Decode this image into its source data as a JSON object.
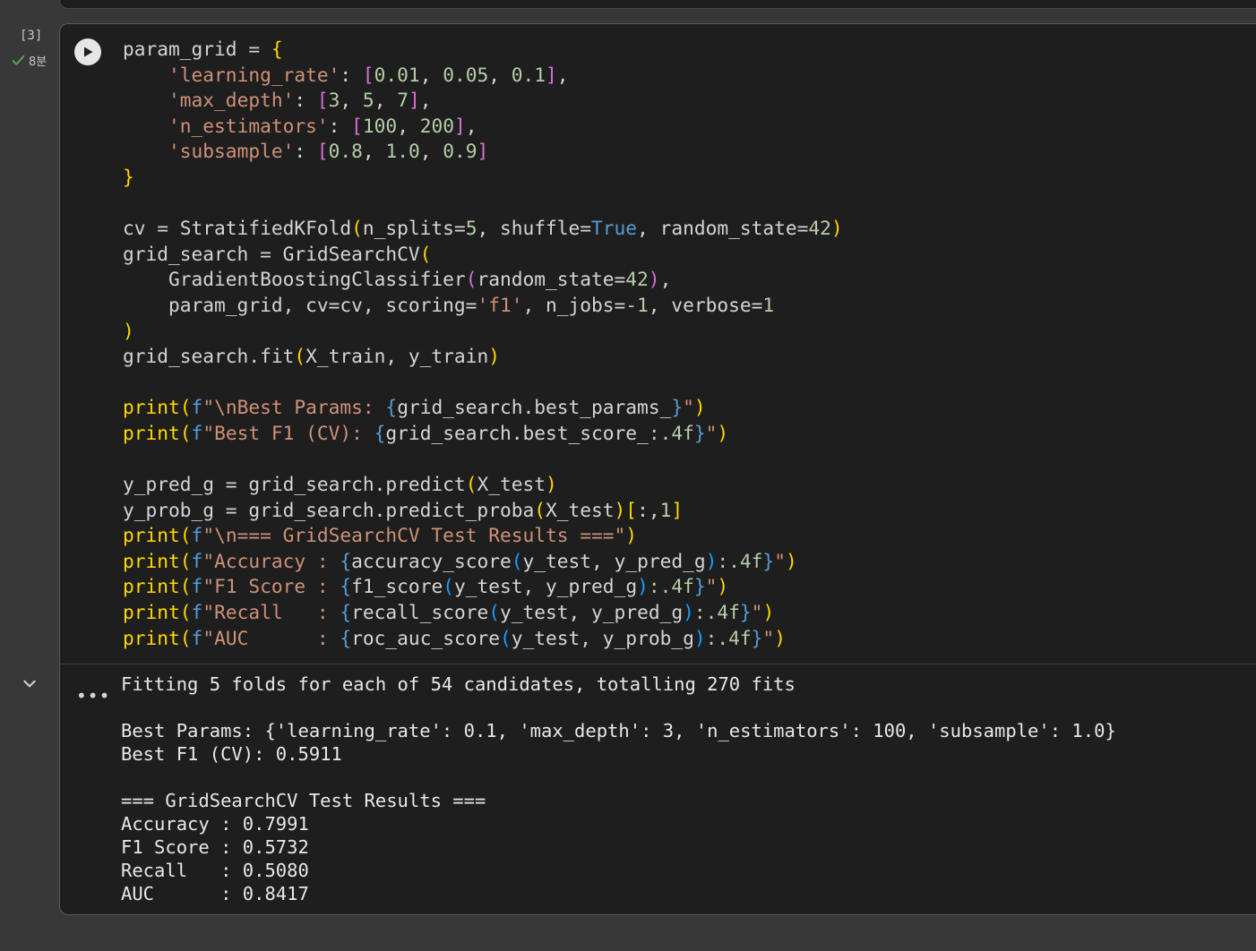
{
  "cell": {
    "execution_count": "[3]",
    "elapsed": "8분",
    "code_lines": [
      [
        {
          "t": "param_grid = "
        },
        {
          "t": "{",
          "c": "y"
        }
      ],
      [
        {
          "t": "    "
        },
        {
          "t": "'learning_rate'",
          "c": "s"
        },
        {
          "t": ": "
        },
        {
          "t": "[",
          "c": "m"
        },
        {
          "t": "0.01",
          "c": "n"
        },
        {
          "t": ", "
        },
        {
          "t": "0.05",
          "c": "n"
        },
        {
          "t": ", "
        },
        {
          "t": "0.1",
          "c": "n"
        },
        {
          "t": "]",
          "c": "m"
        },
        {
          "t": ","
        }
      ],
      [
        {
          "t": "    "
        },
        {
          "t": "'max_depth'",
          "c": "s"
        },
        {
          "t": ": "
        },
        {
          "t": "[",
          "c": "m"
        },
        {
          "t": "3",
          "c": "n"
        },
        {
          "t": ", "
        },
        {
          "t": "5",
          "c": "n"
        },
        {
          "t": ", "
        },
        {
          "t": "7",
          "c": "n"
        },
        {
          "t": "]",
          "c": "m"
        },
        {
          "t": ","
        }
      ],
      [
        {
          "t": "    "
        },
        {
          "t": "'n_estimators'",
          "c": "s"
        },
        {
          "t": ": "
        },
        {
          "t": "[",
          "c": "m"
        },
        {
          "t": "100",
          "c": "n"
        },
        {
          "t": ", "
        },
        {
          "t": "200",
          "c": "n"
        },
        {
          "t": "]",
          "c": "m"
        },
        {
          "t": ","
        }
      ],
      [
        {
          "t": "    "
        },
        {
          "t": "'subsample'",
          "c": "s"
        },
        {
          "t": ": "
        },
        {
          "t": "[",
          "c": "m"
        },
        {
          "t": "0.8",
          "c": "n"
        },
        {
          "t": ", "
        },
        {
          "t": "1.0",
          "c": "n"
        },
        {
          "t": ", "
        },
        {
          "t": "0.9",
          "c": "n"
        },
        {
          "t": "]",
          "c": "m"
        }
      ],
      [
        {
          "t": "}",
          "c": "y"
        }
      ],
      [
        {
          "t": ""
        }
      ],
      [
        {
          "t": "cv = StratifiedKFold"
        },
        {
          "t": "(",
          "c": "y"
        },
        {
          "t": "n_splits="
        },
        {
          "t": "5",
          "c": "n"
        },
        {
          "t": ", shuffle="
        },
        {
          "t": "True",
          "c": "b"
        },
        {
          "t": ", random_state="
        },
        {
          "t": "42",
          "c": "n"
        },
        {
          "t": ")",
          "c": "y"
        }
      ],
      [
        {
          "t": "grid_search = GridSearchCV"
        },
        {
          "t": "(",
          "c": "y"
        }
      ],
      [
        {
          "t": "    GradientBoostingClassifier"
        },
        {
          "t": "(",
          "c": "m"
        },
        {
          "t": "random_state="
        },
        {
          "t": "42",
          "c": "n"
        },
        {
          "t": ")",
          "c": "m"
        },
        {
          "t": ","
        }
      ],
      [
        {
          "t": "    param_grid, cv=cv, scoring="
        },
        {
          "t": "'f1'",
          "c": "s"
        },
        {
          "t": ", n_jobs="
        },
        {
          "t": "-1",
          "c": "n"
        },
        {
          "t": ", verbose="
        },
        {
          "t": "1",
          "c": "n"
        }
      ],
      [
        {
          "t": ")",
          "c": "y"
        }
      ],
      [
        {
          "t": "grid_search.fit"
        },
        {
          "t": "(",
          "c": "y"
        },
        {
          "t": "X_train, y_train"
        },
        {
          "t": ")",
          "c": "y"
        }
      ],
      [
        {
          "t": ""
        }
      ],
      [
        {
          "t": "print",
          "c": "y"
        },
        {
          "t": "(",
          "c": "y"
        },
        {
          "t": "f",
          "c": "b"
        },
        {
          "t": "\"\\nBest Params: ",
          "c": "s"
        },
        {
          "t": "{",
          "c": "b"
        },
        {
          "t": "grid_search.best_params_"
        },
        {
          "t": "}",
          "c": "b"
        },
        {
          "t": "\"",
          "c": "s"
        },
        {
          "t": ")",
          "c": "y"
        }
      ],
      [
        {
          "t": "print",
          "c": "y"
        },
        {
          "t": "(",
          "c": "y"
        },
        {
          "t": "f",
          "c": "b"
        },
        {
          "t": "\"Best F1 (CV): ",
          "c": "s"
        },
        {
          "t": "{",
          "c": "b"
        },
        {
          "t": "grid_search.best_score_"
        },
        {
          "t": ":.4f",
          "c": "n"
        },
        {
          "t": "}",
          "c": "b"
        },
        {
          "t": "\"",
          "c": "s"
        },
        {
          "t": ")",
          "c": "y"
        }
      ],
      [
        {
          "t": ""
        }
      ],
      [
        {
          "t": "y_pred_g = grid_search.predict"
        },
        {
          "t": "(",
          "c": "y"
        },
        {
          "t": "X_test"
        },
        {
          "t": ")",
          "c": "y"
        }
      ],
      [
        {
          "t": "y_prob_g = grid_search.predict_proba"
        },
        {
          "t": "(",
          "c": "y"
        },
        {
          "t": "X_test"
        },
        {
          "t": ")",
          "c": "y"
        },
        {
          "t": "[",
          "c": "y"
        },
        {
          "t": ":,"
        },
        {
          "t": "1",
          "c": "n"
        },
        {
          "t": "]",
          "c": "y"
        }
      ],
      [
        {
          "t": "print",
          "c": "y"
        },
        {
          "t": "(",
          "c": "y"
        },
        {
          "t": "f",
          "c": "b"
        },
        {
          "t": "\"\\n=== GridSearchCV Test Results ===\"",
          "c": "s"
        },
        {
          "t": ")",
          "c": "y"
        }
      ],
      [
        {
          "t": "print",
          "c": "y"
        },
        {
          "t": "(",
          "c": "y"
        },
        {
          "t": "f",
          "c": "b"
        },
        {
          "t": "\"Accuracy : ",
          "c": "s"
        },
        {
          "t": "{",
          "c": "b"
        },
        {
          "t": "accuracy_score"
        },
        {
          "t": "(",
          "c": "c"
        },
        {
          "t": "y_test, y_pred_g"
        },
        {
          "t": ")",
          "c": "c"
        },
        {
          "t": ":.4f",
          "c": "n"
        },
        {
          "t": "}",
          "c": "b"
        },
        {
          "t": "\"",
          "c": "s"
        },
        {
          "t": ")",
          "c": "y"
        }
      ],
      [
        {
          "t": "print",
          "c": "y"
        },
        {
          "t": "(",
          "c": "y"
        },
        {
          "t": "f",
          "c": "b"
        },
        {
          "t": "\"F1 Score : ",
          "c": "s"
        },
        {
          "t": "{",
          "c": "b"
        },
        {
          "t": "f1_score"
        },
        {
          "t": "(",
          "c": "c"
        },
        {
          "t": "y_test, y_pred_g"
        },
        {
          "t": ")",
          "c": "c"
        },
        {
          "t": ":.4f",
          "c": "n"
        },
        {
          "t": "}",
          "c": "b"
        },
        {
          "t": "\"",
          "c": "s"
        },
        {
          "t": ")",
          "c": "y"
        }
      ],
      [
        {
          "t": "print",
          "c": "y"
        },
        {
          "t": "(",
          "c": "y"
        },
        {
          "t": "f",
          "c": "b"
        },
        {
          "t": "\"Recall   : ",
          "c": "s"
        },
        {
          "t": "{",
          "c": "b"
        },
        {
          "t": "recall_score"
        },
        {
          "t": "(",
          "c": "c"
        },
        {
          "t": "y_test, y_pred_g"
        },
        {
          "t": ")",
          "c": "c"
        },
        {
          "t": ":.4f",
          "c": "n"
        },
        {
          "t": "}",
          "c": "b"
        },
        {
          "t": "\"",
          "c": "s"
        },
        {
          "t": ")",
          "c": "y"
        }
      ],
      [
        {
          "t": "print",
          "c": "y"
        },
        {
          "t": "(",
          "c": "y"
        },
        {
          "t": "f",
          "c": "b"
        },
        {
          "t": "\"AUC      : ",
          "c": "s"
        },
        {
          "t": "{",
          "c": "b"
        },
        {
          "t": "roc_auc_score"
        },
        {
          "t": "(",
          "c": "c"
        },
        {
          "t": "y_test, y_prob_g"
        },
        {
          "t": ")",
          "c": "c"
        },
        {
          "t": ":.4f",
          "c": "n"
        },
        {
          "t": "}",
          "c": "b"
        },
        {
          "t": "\"",
          "c": "s"
        },
        {
          "t": ")",
          "c": "y"
        }
      ]
    ],
    "output_lines": [
      "Fitting 5 folds for each of 54 candidates, totalling 270 fits",
      "",
      "Best Params: {'learning_rate': 0.1, 'max_depth': 3, 'n_estimators': 100, 'subsample': 1.0}",
      "Best F1 (CV): 0.5911",
      "",
      "=== GridSearchCV Test Results ===",
      "Accuracy : 0.7991",
      "F1 Score : 0.5732",
      "Recall   : 0.5080",
      "AUC      : 0.8417"
    ]
  },
  "colors": {
    "success": "#4caf50",
    "background": "#383838",
    "cell_background": "#1e1e1e"
  },
  "icons": {
    "run": "play-icon",
    "status": "check-icon",
    "toggle": "chevron-down-icon",
    "more": "more-icon"
  }
}
